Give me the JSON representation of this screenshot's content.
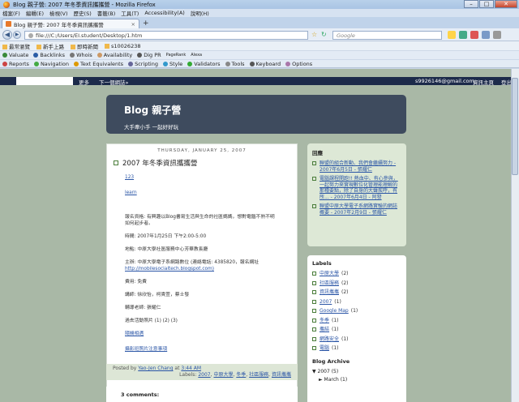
{
  "window": {
    "title": "Blog 親子營: 2007 年冬季資訊攜攜營 - Mozilla Firefox",
    "buttons": [
      "–",
      "□",
      "✕"
    ]
  },
  "menu": [
    "檔案(F)",
    "編輯(E)",
    "檢視(V)",
    "歷史(S)",
    "書籤(B)",
    "工具(T)",
    "Accessibility(A)",
    "說明(H)"
  ],
  "tab": {
    "label": "Blog 親子營: 2007 年冬季資訊攜攜營",
    "new": "+"
  },
  "nav": {
    "url": "file:///C:/Users/EI.student/Desktop/1.htm",
    "search_placeholder": "Google"
  },
  "bookmarks": [
    "最常瀏覽",
    "新手上路",
    "即時新聞",
    "s10026238"
  ],
  "toolbar2": [
    "Valuate",
    "Backlinks",
    "Whois",
    "Availability",
    "Dig PR",
    "PageRank",
    "Alexa"
  ],
  "toolbar3": [
    "Reports",
    "Navigation",
    "Text Equivalents",
    "Scripting",
    "Style",
    "Validators",
    "Tools",
    "Keyboard",
    "Options"
  ],
  "blogger": {
    "more": "更多",
    "next": "下一個網誌»",
    "email": "s9926146@gmail.com",
    "dashboard": "資訊主頁",
    "logout": "登出"
  },
  "header": {
    "title": "Blog 親子營",
    "description": "大手牽小手 一起好好玩"
  },
  "post": {
    "date": "Thursday, January 25, 2007",
    "title": "2007 年冬季資訊攜攜營",
    "link1": "123",
    "link2": "learn",
    "p1": "報名資格: 有興趣以Blog書寫生活與生命的社區媽媽，想對電腦不熟不明如何起步者。",
    "p2": "時間: 2007年1月25日 下午2:00-5:00",
    "p3": "地點: 中原大學社區服務中心芳華教長廳",
    "p4a": "主辦: 中原大學電子系網路數位 (連絡電話: 4385820，報名網址",
    "p4b": "http://mobilesocialtech.blogspot.com)",
    "p5": "費用: 免費",
    "p6": "講師: 徐欣怡，柯貴萱，蔡士發",
    "p7": "輔導老師: 張耀仁",
    "p8": "過去活動照片 (1) (2) (3)",
    "link3": "隨機相遇",
    "link4": "攝影班照片注意事項",
    "posted_by": "Posted by",
    "author": "Yao-Jen Chang",
    "at": "at",
    "time": "3:44 AM",
    "labels_prefix": "Labels:",
    "labels": [
      "2007",
      "中原大學",
      "冬季",
      "社區服務",
      "資訊攜攜"
    ],
    "comments": "3 comments:"
  },
  "sidebar": {
    "related_title": "回應",
    "related": [
      "聯盟的組合新動、我們會繼續努力 - 2007年6月5日 - 張耀仁",
      "電腦課程開跑!! 熱血中、有心參與，一起努力來實現數位化管理能理解的那種要點，除了自身的大聲疾呼，有所... - 2007年6月4日 - 阿發",
      "聯盟中原大學電子系網路實驗的網誌概要 - 2007年2月9日 - 張耀仁"
    ],
    "labels_title": "Labels",
    "labels": [
      {
        "name": "中原大學",
        "count": "(2)"
      },
      {
        "name": "社區服務",
        "count": "(2)"
      },
      {
        "name": "資訊攜攜",
        "count": "(2)"
      },
      {
        "name": "2007",
        "count": "(1)"
      },
      {
        "name": "Google Map",
        "count": "(1)"
      },
      {
        "name": "冬季",
        "count": "(1)"
      },
      {
        "name": "攜結",
        "count": "(1)"
      },
      {
        "name": "網路安全",
        "count": "(1)"
      },
      {
        "name": "電腦",
        "count": "(1)"
      }
    ],
    "archive_title": "Blog Archive",
    "archive_year": "▼ 2007 (5)",
    "archive_month": "► March (1)"
  }
}
